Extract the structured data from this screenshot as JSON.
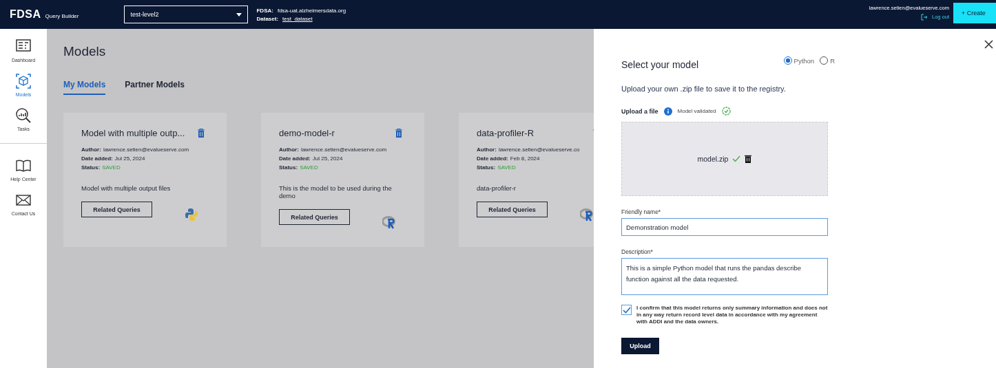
{
  "header": {
    "logo": "FDSA",
    "app_name": "Query Builder",
    "project_select": {
      "value": "test-level2"
    },
    "fdsa_label": "FDSA:",
    "fdsa_value": "fdsa-uat.alzheimersdata.org",
    "dataset_label": "Dataset:",
    "dataset_value": "test_dataset",
    "user_email": "lawrence.setien@evalueserve.com",
    "logout": "Log out",
    "create_button": "+ Create"
  },
  "sidebar": {
    "items": [
      {
        "label": "Dashboard",
        "kind": "dashboard",
        "selected": false
      },
      {
        "label": "Models",
        "kind": "models",
        "selected": true
      },
      {
        "label": "Tasks",
        "kind": "tasks",
        "selected": false
      },
      {
        "label": "Help Center",
        "kind": "help",
        "selected": false
      },
      {
        "label": "Contact Us",
        "kind": "contact",
        "selected": false
      }
    ]
  },
  "page": {
    "title": "Models",
    "tabs": [
      {
        "label": "My Models",
        "selected": true
      },
      {
        "label": "Partner Models",
        "selected": false
      }
    ]
  },
  "models": [
    {
      "name": "Model with multiple outp...",
      "author_label": "Author:",
      "author": "lawrence.setien@evalueserve.com",
      "date_label": "Date added:",
      "date": "Jul 25, 2024",
      "status_label": "Status:",
      "status": "SAVED",
      "description": "Model with multiple output files",
      "button": "Related Queries",
      "kind": "python"
    },
    {
      "name": "demo-model-r",
      "author_label": "Author:",
      "author": "lawrence.setien@evalueserve.com",
      "date_label": "Date added:",
      "date": "Jul 25, 2024",
      "status_label": "Status:",
      "status": "SAVED",
      "description": "This is the model to be used during the demo",
      "button": "Related Queries",
      "kind": "r"
    },
    {
      "name": "data-profiler-R",
      "author_label": "Author:",
      "author": "lawrence.setien@evalueserve.co",
      "date_label": "Date added:",
      "date": "Feb 8, 2024",
      "status_label": "Status:",
      "status": "SAVED",
      "description": "data-profiler-r",
      "button": "Related Queries",
      "kind": "r"
    }
  ],
  "panel": {
    "title": "Select your model",
    "languages": [
      {
        "label": "Python",
        "selected": true
      },
      {
        "label": "R",
        "selected": false
      }
    ],
    "intro": "Upload your own .zip file to save it to the registry.",
    "upload_label": "Upload a file",
    "validation": "Model validated",
    "file_name": "model.zip",
    "friendly_name": {
      "label": "Friendly name*",
      "value": "Demonstration model"
    },
    "description": {
      "label": "Description*",
      "value": "This is a simple Python model that runs the pandas describe function against all the data requested."
    },
    "confirm": {
      "text": "I confirm that this model returns only summary information and does not in any way return record level data in accordance with my agreement with ADDI and the data owners.",
      "checked": true
    },
    "upload_button": "Upload"
  }
}
